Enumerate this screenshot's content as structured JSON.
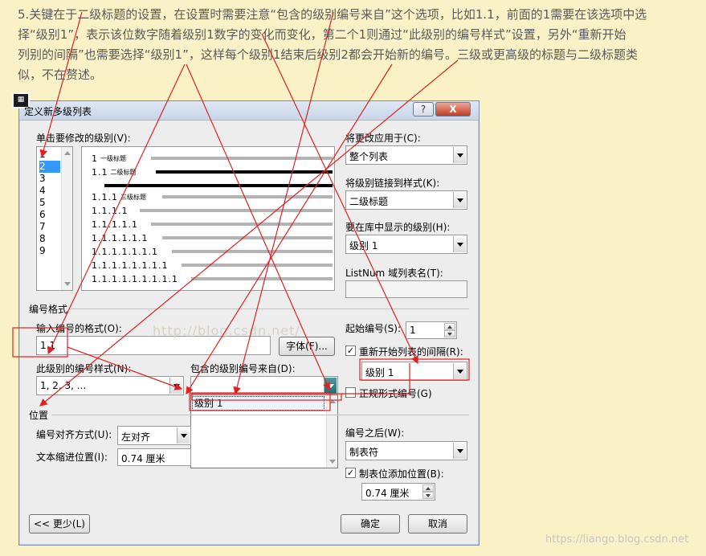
{
  "paragraph": {
    "lines": [
      "5.关键在于二级标题的设置，在设置时需要注意“包含的级别编号来自”这个选项，比如1.1，前面的1需要在该选项中选",
      "择“级别1”，表示该位数字随着级别1数字的变化而变化，第二个1则通过“此级别的编号样式”设置，另外“重新开始",
      "列别的间隔”也需要选择“级别1”，这样每个级别1结束后级别2都会开始新的编号。三级或更高级的标题与二级标题类",
      "似，不在赘述。"
    ]
  },
  "dialog": {
    "title": "定义新多级列表",
    "help_label": "?",
    "close_label": "X",
    "app_icon": "dialog-app-icon",
    "level_list": {
      "label": "单击要修改的级别(V):",
      "items": [
        "1",
        "2",
        "3",
        "4",
        "5",
        "6",
        "7",
        "8",
        "9"
      ],
      "selected": "2"
    },
    "preview": {
      "rows": [
        {
          "num": "1",
          "hdr": "一级标题"
        },
        {
          "num": "1.1",
          "hdr": "二级标题"
        },
        {
          "num": "1.1.1",
          "hdr": "三级标题"
        },
        {
          "num": "1.1.1.1",
          "hdr": ""
        },
        {
          "num": "1.1.1.1.1",
          "hdr": ""
        },
        {
          "num": "1.1.1.1.1.1",
          "hdr": ""
        },
        {
          "num": "1.1.1.1.1.1.1",
          "hdr": ""
        },
        {
          "num": "1.1.1.1.1.1.1.1",
          "hdr": ""
        },
        {
          "num": "1.1.1.1.1.1.1.1.1",
          "hdr": ""
        }
      ]
    },
    "apply_to": {
      "label": "将更改应用于(C):",
      "value": "整个列表"
    },
    "link_style": {
      "label": "将级别链接到样式(K):",
      "value": "二级标题"
    },
    "gallery_level": {
      "label": "要在库中显示的级别(H):",
      "value": "级别 1"
    },
    "listnum": {
      "label": "ListNum 域列表名(T):",
      "value": ""
    },
    "number_format": {
      "group_label": "编号格式",
      "format_label": "输入编号的格式(O):",
      "format_value": "1.1",
      "font_button": "字体(F)...",
      "style_label": "此级别的编号样式(N):",
      "style_value": "1, 2, 3, ...",
      "include_label": "包含的级别编号来自(D):",
      "include_value": "",
      "include_option": "级别 1",
      "start_label": "起始编号(S):",
      "start_value": "1",
      "restart_label": "重新开始列表的间隔(R):",
      "restart_checked": true,
      "restart_value": "级别 1",
      "legal_label": "正规形式编号(G)",
      "legal_checked": false
    },
    "position": {
      "group_label": "位置",
      "align_label": "编号对齐方式(U):",
      "align_value": "左对齐",
      "indent_label": "文本缩进位置(I):",
      "indent_value": "0.74 厘米",
      "after_label": "编号之后(W):",
      "after_value": "制表符",
      "tab_label": "制表位添加位置(B):",
      "tab_checked": true,
      "tab_value": "0.74 厘米"
    },
    "buttons": {
      "less": "<< 更少(L)",
      "ok": "确定",
      "cancel": "取消"
    }
  },
  "watermarks": {
    "middle": "http://blog.csdn.net/",
    "bottom": "https://liango.blog.csdn.net"
  },
  "colors": {
    "annotation": "#e12121",
    "selection": "#3399ff",
    "page_bg": "#fbf1c7"
  }
}
